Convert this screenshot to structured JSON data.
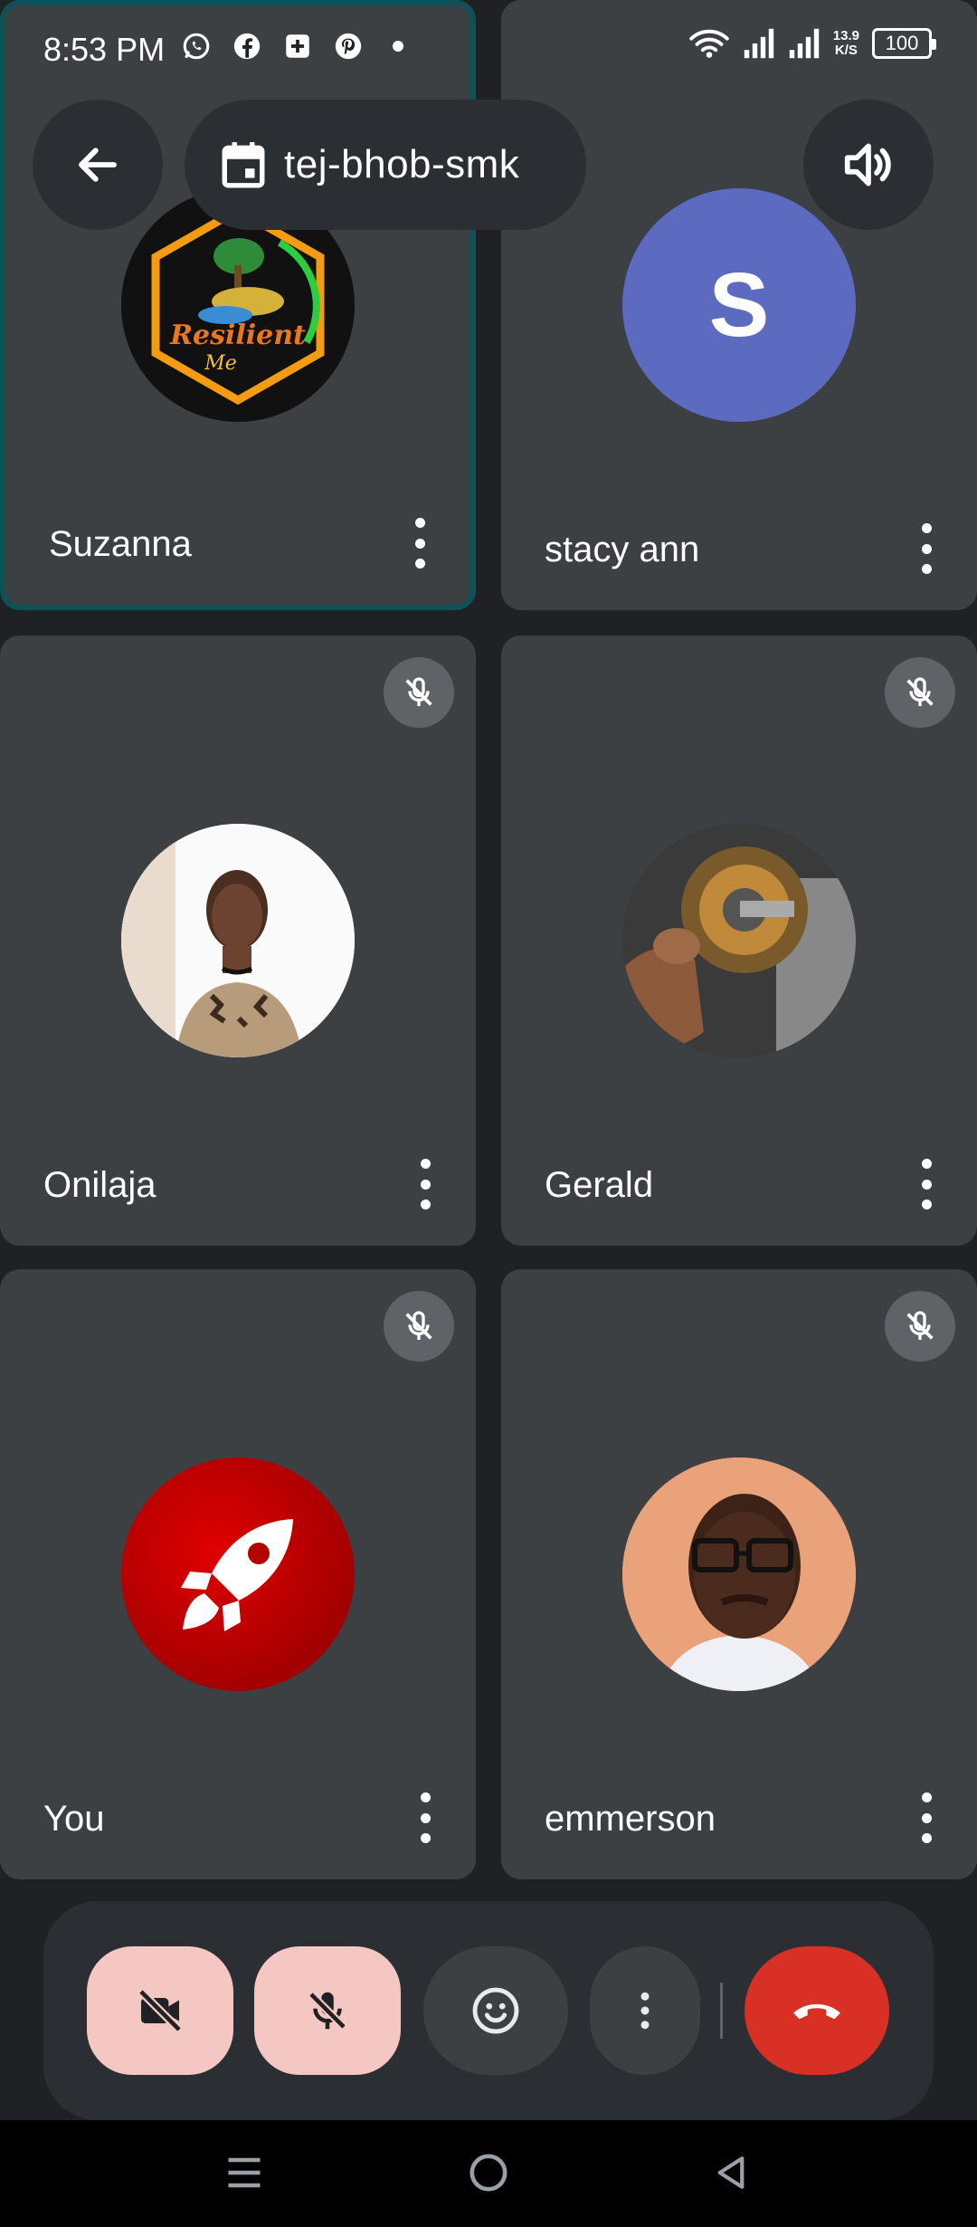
{
  "status_bar": {
    "time": "8:53 PM",
    "network_speed_value": "13.9",
    "network_speed_unit": "K/S",
    "battery": "100",
    "notification_icons": [
      "whatsapp-icon",
      "facebook-icon",
      "calendar-add-icon",
      "pinterest-icon"
    ],
    "system_icons": [
      "wifi-icon",
      "signal-icon",
      "signal-icon"
    ]
  },
  "header": {
    "meeting_code": "tej-bhob-smk",
    "back_icon": "arrow-left-icon",
    "calendar_icon": "calendar-icon",
    "speaker_icon": "speaker-volume-icon"
  },
  "participants": [
    {
      "name": "Suzanna",
      "avatar": "resilient-me-logo",
      "muted": false,
      "active": true
    },
    {
      "name": "stacy ann",
      "avatar_initial": "S",
      "avatar_color": "#5c6bc0",
      "muted": false,
      "active": false
    },
    {
      "name": "Onilaja",
      "avatar": "photo-woman",
      "muted": true,
      "active": false
    },
    {
      "name": "Gerald",
      "avatar": "photo-motor-coil",
      "muted": true,
      "active": false
    },
    {
      "name": "You",
      "avatar": "rocket-icon",
      "muted": true,
      "active": false
    },
    {
      "name": "emmerson",
      "avatar": "photo-man-glasses",
      "muted": true,
      "active": false
    }
  ],
  "controls": {
    "camera": {
      "icon": "video-off-icon",
      "state": "off"
    },
    "microphone": {
      "icon": "mic-off-icon",
      "state": "off"
    },
    "reactions": {
      "icon": "emoji-icon"
    },
    "more": {
      "icon": "more-vertical-icon"
    },
    "end_call": {
      "icon": "end-call-icon"
    }
  },
  "colors": {
    "background": "#202124",
    "tile": "#3c4043",
    "active_border": "#0d5258",
    "pink_button": "#f4c7c3",
    "end_call": "#d93025",
    "avatar_indigo": "#5c6bc0"
  }
}
